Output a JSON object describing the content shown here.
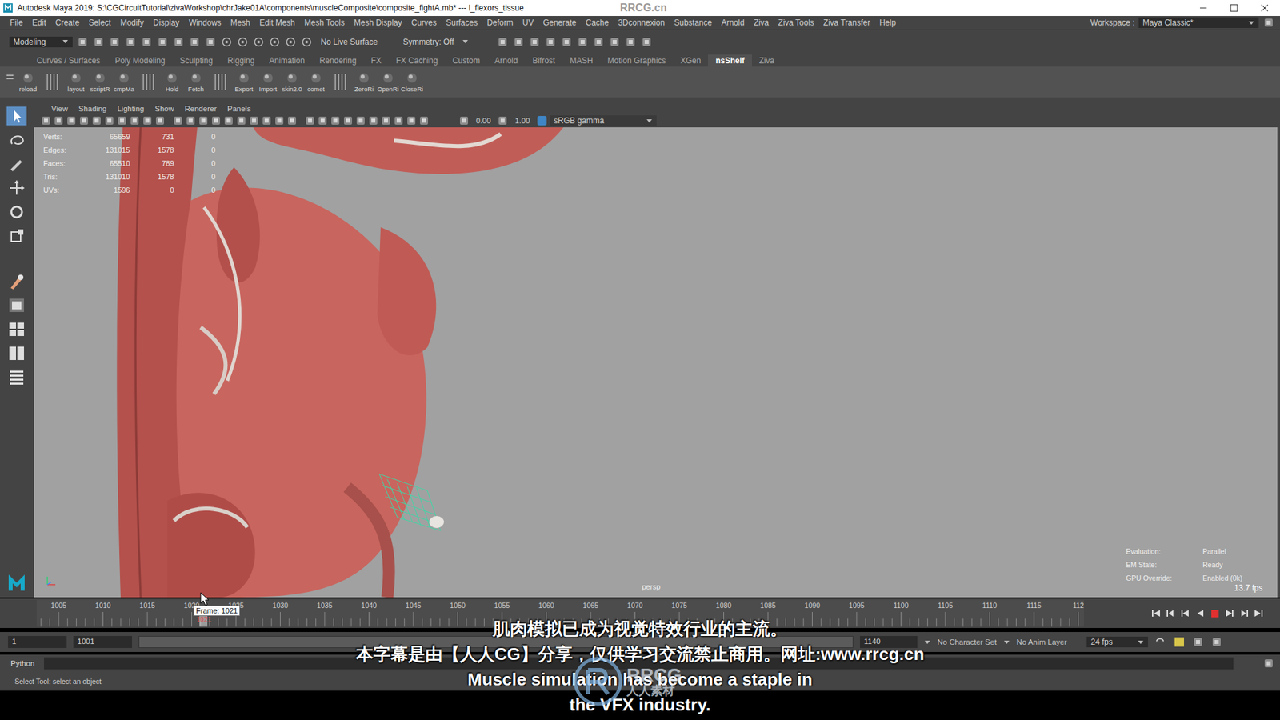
{
  "window": {
    "title": "Autodesk Maya 2019: S:\\CGCircuitTutorial\\zivaWorkshop\\chrJake01A\\components\\muscleComposite\\composite_fightA.mb* --- l_flexors_tissue",
    "watermark": "RRCG.cn"
  },
  "menu": [
    "File",
    "Edit",
    "Create",
    "Select",
    "Modify",
    "Display",
    "Windows",
    "Mesh",
    "Edit Mesh",
    "Mesh Tools",
    "Mesh Display",
    "Curves",
    "Surfaces",
    "Deform",
    "UV",
    "Generate",
    "Cache",
    "3Dconnexion",
    "Substance",
    "Arnold",
    "Ziva",
    "Ziva Tools",
    "Ziva Transfer",
    "Help"
  ],
  "workspace": {
    "label": "Workspace :",
    "value": "Maya Classic*"
  },
  "status_line": {
    "mode": "Modeling",
    "live_surface": "No Live Surface",
    "symmetry": "Symmetry: Off"
  },
  "shelf_tabs": [
    {
      "label": "Curves / Surfaces",
      "selected": false
    },
    {
      "label": "Poly Modeling",
      "selected": false
    },
    {
      "label": "Sculpting",
      "selected": false
    },
    {
      "label": "Rigging",
      "selected": false
    },
    {
      "label": "Animation",
      "selected": false
    },
    {
      "label": "Rendering",
      "selected": false
    },
    {
      "label": "FX",
      "selected": false
    },
    {
      "label": "FX Caching",
      "selected": false
    },
    {
      "label": "Custom",
      "selected": false
    },
    {
      "label": "Arnold",
      "selected": false
    },
    {
      "label": "Bifrost",
      "selected": false
    },
    {
      "label": "MASH",
      "selected": false
    },
    {
      "label": "Motion Graphics",
      "selected": false
    },
    {
      "label": "XGen",
      "selected": false
    },
    {
      "label": "nsShelf",
      "selected": true
    },
    {
      "label": "Ziva",
      "selected": false
    }
  ],
  "shelf_buttons": [
    {
      "kind": "button",
      "label": "reload"
    },
    {
      "kind": "separator"
    },
    {
      "kind": "button",
      "label": "layout"
    },
    {
      "kind": "button",
      "label": "scriptR"
    },
    {
      "kind": "button",
      "label": "cmpMa"
    },
    {
      "kind": "separator"
    },
    {
      "kind": "button",
      "label": "Hold"
    },
    {
      "kind": "button",
      "label": "Fetch"
    },
    {
      "kind": "separator"
    },
    {
      "kind": "button",
      "label": "Export"
    },
    {
      "kind": "button",
      "label": "Import"
    },
    {
      "kind": "button",
      "label": "skin2.0"
    },
    {
      "kind": "button",
      "label": "comet"
    },
    {
      "kind": "separator"
    },
    {
      "kind": "button",
      "label": "ZeroRi"
    },
    {
      "kind": "button",
      "label": "OpenRi"
    },
    {
      "kind": "button",
      "label": "CloseRi"
    }
  ],
  "viewport": {
    "menu": [
      "View",
      "Shading",
      "Lighting",
      "Show",
      "Renderer",
      "Panels"
    ],
    "toolbar": {
      "exposure": "0.00",
      "gamma": "1.00",
      "color_space": "sRGB gamma"
    },
    "hud": [
      [
        "Verts:",
        "65659",
        "731",
        "0"
      ],
      [
        "Edges:",
        "131015",
        "1578",
        "0"
      ],
      [
        "Faces:",
        "65510",
        "789",
        "0"
      ],
      [
        "Tris:",
        "131010",
        "1578",
        "0"
      ],
      [
        "UVs:",
        "1596",
        "0",
        "0"
      ]
    ],
    "camera": "persp",
    "stats": [
      [
        "Evaluation:",
        "Parallel"
      ],
      [
        "EM State:",
        "Ready"
      ],
      [
        "GPU Override:",
        "Enabled (0k)"
      ]
    ],
    "fps": "13.7 fps"
  },
  "timeline": {
    "ticks": [
      "1005",
      "1010",
      "1015",
      "1020",
      "1025",
      "1030",
      "1035",
      "1040",
      "1045",
      "1050",
      "1055",
      "1060",
      "1065",
      "1070",
      "1075",
      "1080",
      "1085",
      "1090",
      "1095",
      "1100",
      "1105",
      "1110",
      "1115",
      "112"
    ],
    "current": "1021",
    "tooltip": "Frame: 1021"
  },
  "range": {
    "start": "1",
    "playback_start": "1001",
    "end": "1140",
    "character_set": "No Character Set",
    "anim_layer": "No Anim Layer",
    "fps": "24 fps"
  },
  "command": {
    "language": "Python"
  },
  "help_line": "Select Tool: select an object",
  "subtitles": [
    "肌肉模拟已成为视觉特效行业的主流。",
    "本字幕是由【人人CG】分享，仅供学习交流禁止商用。网址:www.rrcg.cn",
    "Muscle simulation has become a staple in",
    "the VFX industry."
  ],
  "logo_watermark": {
    "text": "RRCG",
    "subtext": "人人素材"
  }
}
